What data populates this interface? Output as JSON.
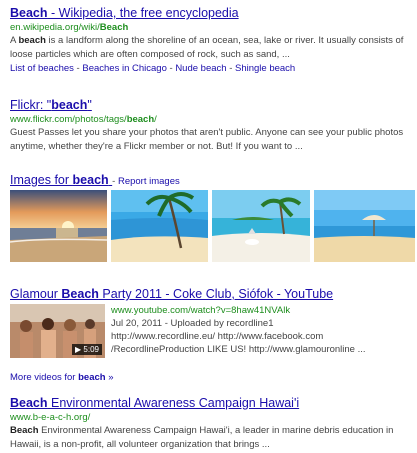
{
  "results": [
    {
      "title_strong": "Beach",
      "title_rest": " - Wikipedia, the free encyclopedia",
      "url_pre": "en.wikipedia.org/wiki/",
      "url_strong": "Beach",
      "snippet_pre": "A ",
      "snippet_strong": "beach",
      "snippet_post": " is a landform along the shoreline of an ocean, sea, lake or river. It usually consists of loose particles which are often composed of rock, such as sand, ...",
      "sitelinks": [
        "List of beaches",
        "Beaches in Chicago",
        "Nude beach",
        "Shingle beach"
      ],
      "sitelink_separator": "-"
    },
    {
      "title_pre": "Flickr: \"",
      "title_strong": "beach",
      "title_post": "\"",
      "url_pre": "www.flickr.com/photos/tags/",
      "url_strong": "beach",
      "url_post": "/",
      "snippet": "Guest Passes let you share your photos that aren't public. Anyone can see your public photos anytime, whether they're a Flickr member or not. But! If you want to ..."
    }
  ],
  "images": {
    "heading_pre": "Images for ",
    "heading_strong": "beach",
    "separator": " - ",
    "report": "Report images"
  },
  "video": {
    "title_pre": "Glamour ",
    "title_strong": "Beach",
    "title_post": " Party 2011 - Coke Club, Siófok - YouTube",
    "url": "www.youtube.com/watch?v=8haw41NVAlk",
    "date_line": "Jul 20, 2011 - Uploaded by recordline1",
    "desc": "http://www.recordline.eu/ http://www.facebook.com /RecordlineProduction LIKE US! http://www.glamouronline ...",
    "duration": "▶ 5:09",
    "more_pre": "More videos for ",
    "more_strong": "beach",
    "more_post": " »"
  },
  "result_hawaii": {
    "title_strong": "Beach",
    "title_rest": " Environmental Awareness Campaign Hawai'i",
    "url": "www.b-e-a-c-h.org/",
    "snippet_strong": "Beach",
    "snippet_post": " Environmental Awareness Campaign Hawai'i, a leader in marine debris education in Hawaii, is a non-profit, all volunteer organization that brings ..."
  },
  "colors": {
    "link": "#1a0dab",
    "url": "#1e8e1e",
    "snippet": "#444444"
  }
}
